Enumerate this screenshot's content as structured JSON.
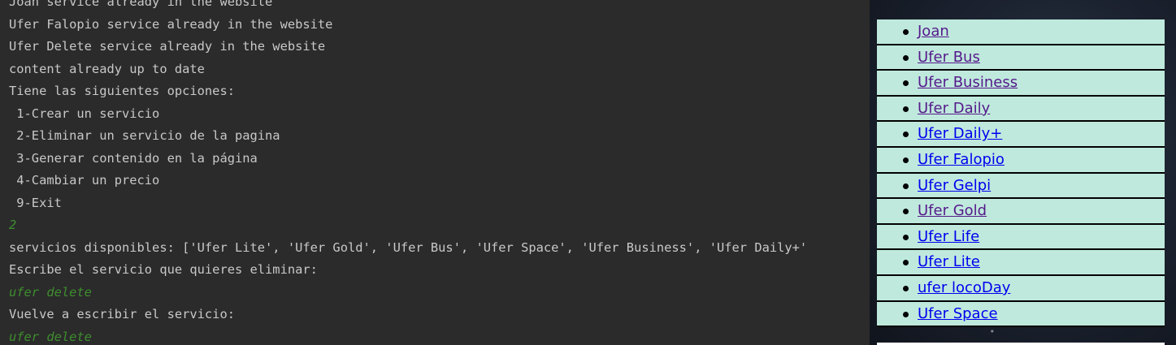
{
  "console": {
    "lines": [
      {
        "text": "Joan service already in the website",
        "kind": "output"
      },
      {
        "text": "Ufer Falopio service already in the website",
        "kind": "output"
      },
      {
        "text": "Ufer Delete service already in the website",
        "kind": "output"
      },
      {
        "text": "content already up to date",
        "kind": "output"
      },
      {
        "text": "Tiene las siguientes opciones:",
        "kind": "output"
      },
      {
        "text": " 1-Crear un servicio",
        "kind": "output"
      },
      {
        "text": " 2-Eliminar un servicio de la pagina",
        "kind": "output"
      },
      {
        "text": " 3-Generar contenido en la página",
        "kind": "output"
      },
      {
        "text": " 4-Cambiar un precio",
        "kind": "output"
      },
      {
        "text": " 9-Exit",
        "kind": "output"
      },
      {
        "text": "2",
        "kind": "input"
      },
      {
        "text": "servicios disponibles: ['Ufer Lite', 'Ufer Gold', 'Ufer Bus', 'Ufer Space', 'Ufer Business', 'Ufer Daily+'",
        "kind": "output"
      },
      {
        "text": "Escribe el servicio que quieres eliminar:",
        "kind": "output"
      },
      {
        "text": "ufer delete",
        "kind": "input"
      },
      {
        "text": "Vuelve a escribir el servicio:",
        "kind": "output"
      },
      {
        "text": "ufer delete",
        "kind": "input"
      }
    ],
    "colors": {
      "background": "#2b2b2b",
      "output_text": "#c8c8c8",
      "input_text": "#3e8e2e"
    }
  },
  "browser": {
    "services": [
      {
        "label": "Joan",
        "visited": true
      },
      {
        "label": "Ufer Bus",
        "visited": true
      },
      {
        "label": "Ufer Business",
        "visited": true
      },
      {
        "label": "Ufer Daily",
        "visited": true
      },
      {
        "label": "Ufer Daily+",
        "visited": false
      },
      {
        "label": "Ufer Falopio",
        "visited": false
      },
      {
        "label": "Ufer Gelpi",
        "visited": false
      },
      {
        "label": "Ufer Gold",
        "visited": true
      },
      {
        "label": "Ufer Life",
        "visited": false
      },
      {
        "label": "Ufer Lite",
        "visited": false
      },
      {
        "label": "ufer locoDay",
        "visited": false
      },
      {
        "label": "Ufer Space",
        "visited": false
      }
    ],
    "colors": {
      "list_background": "#bfe9dd",
      "visited_link": "#551a8b",
      "unvisited_link": "#0000ee",
      "page_background": "starfield-dark"
    }
  }
}
